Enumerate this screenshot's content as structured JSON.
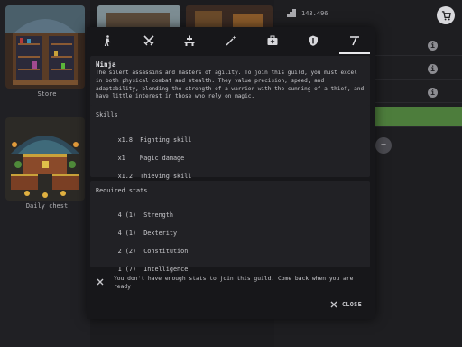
{
  "background": {
    "tiles": [
      {
        "label": "Store",
        "icon": "store-art"
      },
      {
        "label": "Daily chest",
        "icon": "daily-chest-art"
      }
    ],
    "currency_value": "143.496",
    "currency_icon": "stairs-icon",
    "cart_icon": "cart-icon"
  },
  "dialog": {
    "tabs": [
      {
        "name": "tab-walker",
        "icon": "walking-icon",
        "active": false
      },
      {
        "name": "tab-combat",
        "icon": "crossed-swords-icon",
        "active": false
      },
      {
        "name": "tab-construction",
        "icon": "builder-icon",
        "active": false
      },
      {
        "name": "tab-magic",
        "icon": "magic-wand-icon",
        "active": false
      },
      {
        "name": "tab-medic",
        "icon": "medical-kit-icon",
        "active": false
      },
      {
        "name": "tab-defense",
        "icon": "shield-icon",
        "active": false
      },
      {
        "name": "tab-ninja",
        "icon": "kunai-icon",
        "active": true
      }
    ],
    "guild": {
      "name": "Ninja",
      "description": "The silent assassins and masters of agility. To join this guild, you must excel in both physical combat and stealth. They value precision, speed, and adaptability, blending the strength of a warrior with the cunning of a thief, and have little interest in those who rely on magic."
    },
    "skills": {
      "title": "Skills",
      "items": [
        {
          "mult": "x1.8",
          "name": "Fighting skill"
        },
        {
          "mult": "x1",
          "name": "Magic damage"
        },
        {
          "mult": "x1.2",
          "name": "Thieving skill"
        }
      ]
    },
    "required": {
      "title": "Required stats",
      "items": [
        {
          "have": "4",
          "need": "(1)",
          "name": "Strength"
        },
        {
          "have": "4",
          "need": "(1)",
          "name": "Dexterity"
        },
        {
          "have": "2",
          "need": "(2)",
          "name": "Constitution"
        },
        {
          "have": "1",
          "need": "(7)",
          "name": "Intelligence"
        }
      ]
    },
    "warning": "You don't have enough stats to join this guild. Come back when you are ready",
    "close_label": "CLOSE",
    "accent": "#e8e8ec"
  }
}
